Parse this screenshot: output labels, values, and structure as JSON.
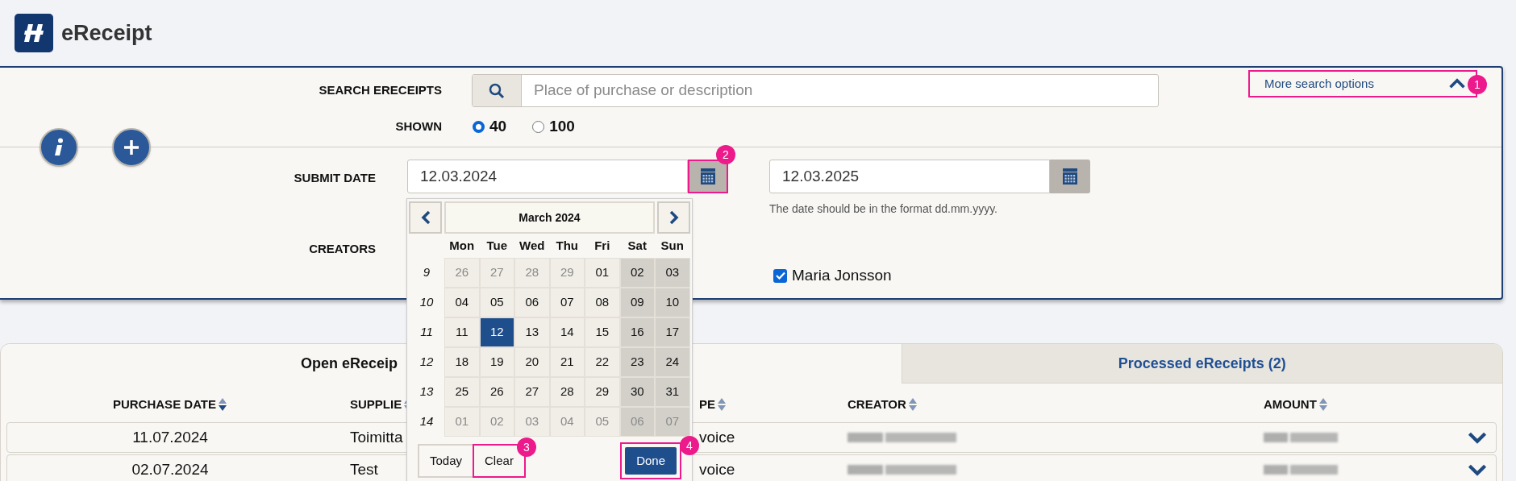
{
  "app": {
    "title": "eReceipt"
  },
  "search": {
    "label": "SEARCH ERECEIPTS",
    "placeholder": "Place of purchase or description",
    "more_options": {
      "label": "More search options",
      "expanded": true
    }
  },
  "shown": {
    "label": "SHOWN",
    "options": [
      {
        "label": "40",
        "selected": true
      },
      {
        "label": "100",
        "selected": false
      }
    ]
  },
  "submit_date": {
    "label": "SUBMIT DATE",
    "from": "12.03.2024",
    "to": "12.03.2025",
    "hint": "The date should be in the format dd.mm.yyyy."
  },
  "creators": {
    "label": "CREATORS",
    "items": [
      {
        "name": "Maria Jonsson",
        "checked": true
      }
    ]
  },
  "callouts": [
    "1",
    "2",
    "3",
    "4"
  ],
  "datepicker": {
    "month": "March 2024",
    "weekdays": [
      "Mon",
      "Tue",
      "Wed",
      "Thu",
      "Fri",
      "Sat",
      "Sun"
    ],
    "weeks": [
      {
        "number": "9",
        "days": [
          {
            "label": "26",
            "muted": true,
            "selected": false
          },
          {
            "label": "27",
            "muted": true,
            "selected": false
          },
          {
            "label": "28",
            "muted": true,
            "selected": false
          },
          {
            "label": "29",
            "muted": true,
            "selected": false
          },
          {
            "label": "01",
            "muted": false,
            "selected": false
          },
          {
            "label": "02",
            "muted": false,
            "selected": false
          },
          {
            "label": "03",
            "muted": false,
            "selected": false
          }
        ]
      },
      {
        "number": "10",
        "days": [
          {
            "label": "04",
            "muted": false,
            "selected": false
          },
          {
            "label": "05",
            "muted": false,
            "selected": false
          },
          {
            "label": "06",
            "muted": false,
            "selected": false
          },
          {
            "label": "07",
            "muted": false,
            "selected": false
          },
          {
            "label": "08",
            "muted": false,
            "selected": false
          },
          {
            "label": "09",
            "muted": false,
            "selected": false
          },
          {
            "label": "10",
            "muted": false,
            "selected": false
          }
        ]
      },
      {
        "number": "11",
        "days": [
          {
            "label": "11",
            "muted": false,
            "selected": false
          },
          {
            "label": "12",
            "muted": false,
            "selected": true
          },
          {
            "label": "13",
            "muted": false,
            "selected": false
          },
          {
            "label": "14",
            "muted": false,
            "selected": false
          },
          {
            "label": "15",
            "muted": false,
            "selected": false
          },
          {
            "label": "16",
            "muted": false,
            "selected": false
          },
          {
            "label": "17",
            "muted": false,
            "selected": false
          }
        ]
      },
      {
        "number": "12",
        "days": [
          {
            "label": "18",
            "muted": false,
            "selected": false
          },
          {
            "label": "19",
            "muted": false,
            "selected": false
          },
          {
            "label": "20",
            "muted": false,
            "selected": false
          },
          {
            "label": "21",
            "muted": false,
            "selected": false
          },
          {
            "label": "22",
            "muted": false,
            "selected": false
          },
          {
            "label": "23",
            "muted": false,
            "selected": false
          },
          {
            "label": "24",
            "muted": false,
            "selected": false
          }
        ]
      },
      {
        "number": "13",
        "days": [
          {
            "label": "25",
            "muted": false,
            "selected": false
          },
          {
            "label": "26",
            "muted": false,
            "selected": false
          },
          {
            "label": "27",
            "muted": false,
            "selected": false
          },
          {
            "label": "28",
            "muted": false,
            "selected": false
          },
          {
            "label": "29",
            "muted": false,
            "selected": false
          },
          {
            "label": "30",
            "muted": false,
            "selected": false
          },
          {
            "label": "31",
            "muted": false,
            "selected": false
          }
        ]
      },
      {
        "number": "14",
        "days": [
          {
            "label": "01",
            "muted": true,
            "selected": false
          },
          {
            "label": "02",
            "muted": true,
            "selected": false
          },
          {
            "label": "03",
            "muted": true,
            "selected": false
          },
          {
            "label": "04",
            "muted": true,
            "selected": false
          },
          {
            "label": "05",
            "muted": true,
            "selected": false
          },
          {
            "label": "06",
            "muted": true,
            "selected": false
          },
          {
            "label": "07",
            "muted": true,
            "selected": false
          }
        ]
      }
    ],
    "buttons": [
      {
        "label": "Today",
        "kind": "plain"
      },
      {
        "label": "Clear",
        "kind": "plain"
      },
      {
        "label": "Done",
        "kind": "primary"
      }
    ]
  },
  "tabs": [
    {
      "label": "Open eReceip",
      "selected": true
    },
    {
      "label": "Processed eReceipts (2)",
      "selected": false
    }
  ],
  "table": {
    "columns": [
      {
        "label": "PURCHASE DATE",
        "sorted_descending": true
      },
      {
        "label": "SUPPLIE",
        "sorted_descending": false
      },
      {
        "label": "PE",
        "sorted_descending": false
      },
      {
        "label": "CREATOR",
        "sorted_descending": false
      },
      {
        "label": "AMOUNT",
        "sorted_descending": false
      }
    ],
    "rows": [
      {
        "cells": [
          "11.07.2024",
          "Toimitta",
          "voice"
        ],
        "expanded": false
      },
      {
        "cells": [
          "02.07.2024",
          "Test",
          "voice"
        ],
        "expanded": false
      }
    ]
  }
}
